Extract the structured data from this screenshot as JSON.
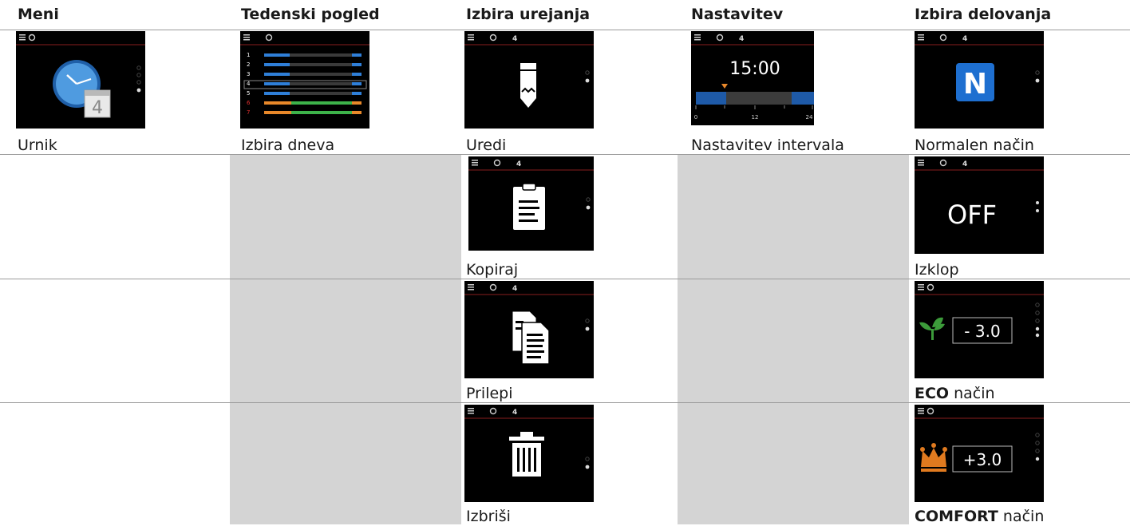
{
  "headers": [
    "Meni",
    "Tedenski pogled",
    "Izbira urejanja",
    "Nastavitev",
    "Izbira delovanja"
  ],
  "captions": {
    "menu": "Urnik",
    "week": "Izbira dneva",
    "edit": [
      "Uredi",
      "Kopiraj",
      "Prilepi",
      "Izbriši"
    ],
    "setting": "Nastavitev intervala",
    "mode": [
      {
        "bold": "",
        "text": "Normalen način"
      },
      {
        "bold": "",
        "text": "Izklop"
      },
      {
        "bold": "ECO",
        "text": " način"
      },
      {
        "bold": "COMFORT",
        "text": " način"
      }
    ]
  },
  "screens": {
    "breadcrumb_edit": "4",
    "week_days": [
      "1",
      "2",
      "3",
      "4",
      "5",
      "6",
      "7"
    ],
    "time": "15:00",
    "axis_ticks": [
      "0",
      "12",
      "24"
    ],
    "mode_letter": "N",
    "off_label": "OFF",
    "eco_value": "- 3.0",
    "comfort_value": "+3.0",
    "calendar_day": "4"
  },
  "colors": {
    "accent_blue": "#2f7fd8",
    "accent_orange": "#e8882a",
    "accent_green": "#3db34a",
    "accent_red": "#c0282a",
    "leaf_green": "#3c9b3a",
    "crown_orange": "#e07a1f"
  }
}
